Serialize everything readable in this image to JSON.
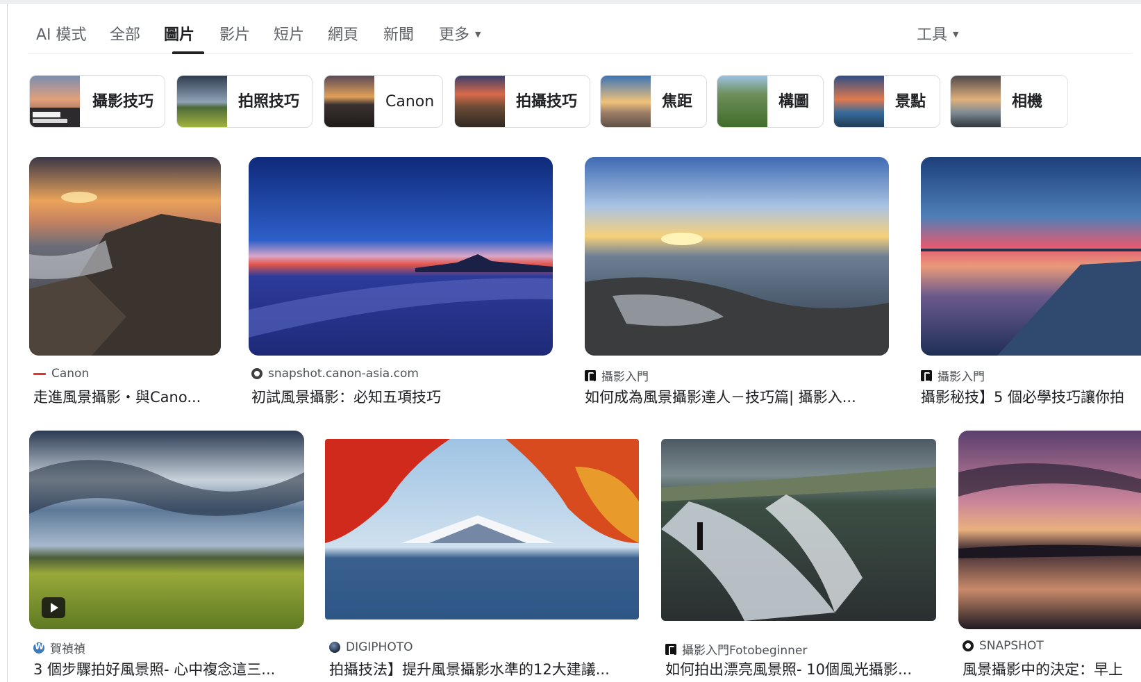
{
  "tabs": [
    {
      "label": "AI 模式"
    },
    {
      "label": "全部"
    },
    {
      "label": "圖片",
      "active": true
    },
    {
      "label": "影片"
    },
    {
      "label": "短片"
    },
    {
      "label": "網頁"
    },
    {
      "label": "新聞"
    },
    {
      "label": "更多"
    }
  ],
  "tools_label": "工具",
  "chips": [
    {
      "label": "攝影技巧"
    },
    {
      "label": "拍照技巧"
    },
    {
      "label": "Canon"
    },
    {
      "label": "拍攝技巧"
    },
    {
      "label": "焦距"
    },
    {
      "label": "構圖"
    },
    {
      "label": "景點"
    },
    {
      "label": "相機"
    }
  ],
  "results": [
    {
      "source": "Canon",
      "title": "走進風景攝影・與Cano..."
    },
    {
      "source": "snapshot.canon-asia.com",
      "title": "初試風景攝影：必知五項技巧"
    },
    {
      "source": "攝影入門",
      "title": "如何成為風景攝影達人－技巧篇| 攝影入..."
    },
    {
      "source": "攝影入門",
      "title": "攝影秘技】5 個必學技巧讓你拍"
    },
    {
      "source": "賀禎禎",
      "title": "3 個步驟拍好風景照- 心中複念這三..."
    },
    {
      "source": "DIGIPHOTO",
      "title": "拍攝技法】提升風景攝影水準的12大建議..."
    },
    {
      "source": "攝影入門Fotobeginner",
      "title": "如何拍出漂亮風景照- 10個風光攝影..."
    },
    {
      "source": "SNAPSHOT",
      "title": "風景攝影中的決定：早上"
    }
  ]
}
